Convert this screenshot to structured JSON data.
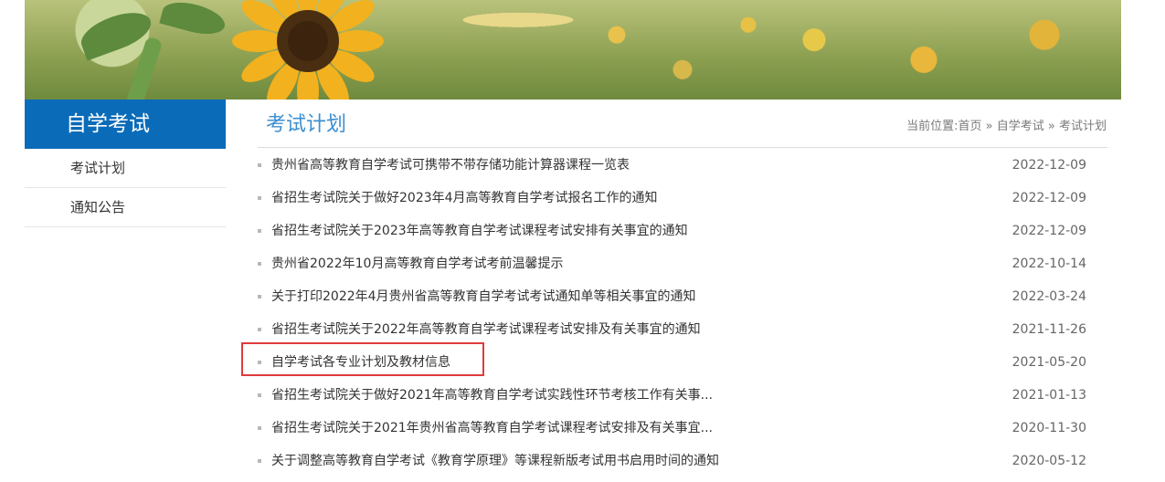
{
  "sidebar": {
    "title": "自学考试",
    "items": [
      {
        "label": "考试计划"
      },
      {
        "label": "通知公告"
      }
    ]
  },
  "main": {
    "title": "考试计划",
    "breadcrumb": {
      "prefix": "当前位置:",
      "links": [
        "首页",
        "自学考试",
        "考试计划"
      ],
      "separator": "»"
    }
  },
  "list": [
    {
      "title": "贵州省高等教育自学考试可携带不带存储功能计算器课程一览表",
      "date": "2022-12-09"
    },
    {
      "title": "省招生考试院关于做好2023年4月高等教育自学考试报名工作的通知",
      "date": "2022-12-09"
    },
    {
      "title": "省招生考试院关于2023年高等教育自学考试课程考试安排有关事宜的通知",
      "date": "2022-12-09"
    },
    {
      "title": "贵州省2022年10月高等教育自学考试考前温馨提示",
      "date": "2022-10-14"
    },
    {
      "title": "关于打印2022年4月贵州省高等教育自学考试考试通知单等相关事宜的通知",
      "date": "2022-03-24"
    },
    {
      "title": "省招生考试院关于2022年高等教育自学考试课程考试安排及有关事宜的通知",
      "date": "2021-11-26"
    },
    {
      "title": "自学考试各专业计划及教材信息",
      "date": "2021-05-20"
    },
    {
      "title": "省招生考试院关于做好2021年高等教育自学考试实践性环节考核工作有关事...",
      "date": "2021-01-13"
    },
    {
      "title": "省招生考试院关于2021年贵州省高等教育自学考试课程考试安排及有关事宜...",
      "date": "2020-11-30"
    },
    {
      "title": "关于调整高等教育自学考试《教育学原理》等课程新版考试用书启用时间的通知",
      "date": "2020-05-12"
    }
  ]
}
